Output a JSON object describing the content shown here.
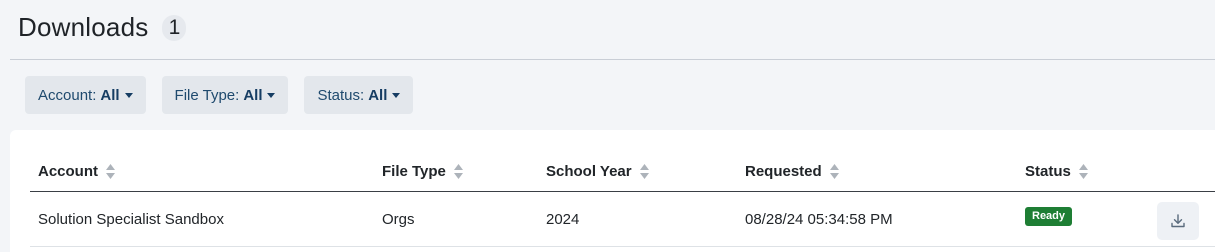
{
  "header": {
    "title": "Downloads",
    "count": "1"
  },
  "filters": [
    {
      "label": "Account:",
      "value": "All"
    },
    {
      "label": "File Type:",
      "value": "All"
    },
    {
      "label": "Status:",
      "value": "All"
    }
  ],
  "table": {
    "columns": [
      "Account",
      "File Type",
      "School Year",
      "Requested",
      "Status"
    ],
    "rows": [
      {
        "account": "Solution Specialist Sandbox",
        "file_type": "Orgs",
        "school_year": "2024",
        "requested": "08/28/24 05:34:58 PM",
        "status": "Ready"
      }
    ]
  },
  "icons": {
    "sort": "sort-icon",
    "download": "download-icon",
    "caret": "caret-down-icon"
  },
  "colors": {
    "status_ready": "#1e7e34",
    "filter_text": "#163d63"
  }
}
